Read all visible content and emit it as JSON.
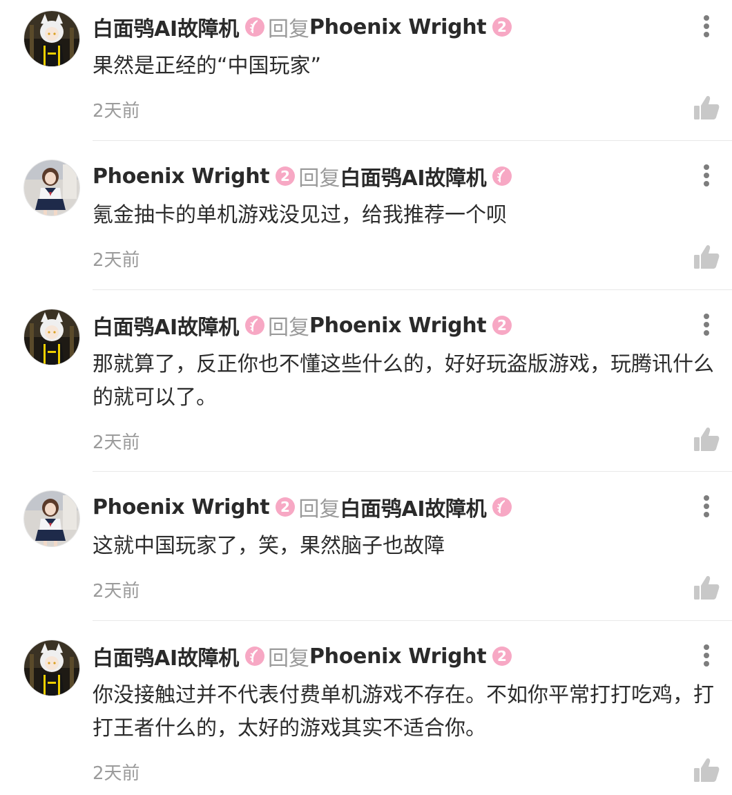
{
  "reply_label": "回复",
  "comments": [
    {
      "author": "白面鸮AI故障机",
      "author_badge": "feather",
      "reply_to": "Phoenix Wright",
      "reply_to_badge": "level-2",
      "text": "果然是正经的“中国玩家”",
      "time": "2天前"
    },
    {
      "author": "Phoenix Wright",
      "author_badge": "level-2",
      "reply_to": "白面鸮AI故障机",
      "reply_to_badge": "feather",
      "text": "氪金抽卡的单机游戏没见过，给我推荐一个呗",
      "time": "2天前"
    },
    {
      "author": "白面鸮AI故障机",
      "author_badge": "feather",
      "reply_to": "Phoenix Wright",
      "reply_to_badge": "level-2",
      "text": "那就算了，反正你也不懂这些什么的，好好玩盗版游戏，玩腾讯什么的就可以了。",
      "time": "2天前"
    },
    {
      "author": "Phoenix Wright",
      "author_badge": "level-2",
      "reply_to": "白面鸮AI故障机",
      "reply_to_badge": "feather",
      "text": "这就中国玩家了，笑，果然脑子也故障",
      "time": "2天前"
    },
    {
      "author": "白面鸮AI故障机",
      "author_badge": "feather",
      "reply_to": "Phoenix Wright",
      "reply_to_badge": "level-2",
      "text": "你没接触过并不代表付费单机游戏不存在。不如你平常打打吃鸡，打打王者什么的，太好的游戏其实不适合你。",
      "time": "2天前"
    }
  ],
  "colors": {
    "badge_pink": "#f7a8c4",
    "text_primary": "#2c2c2c",
    "text_secondary": "#9b9b9b",
    "icon_gray": "#c8c8c8"
  }
}
